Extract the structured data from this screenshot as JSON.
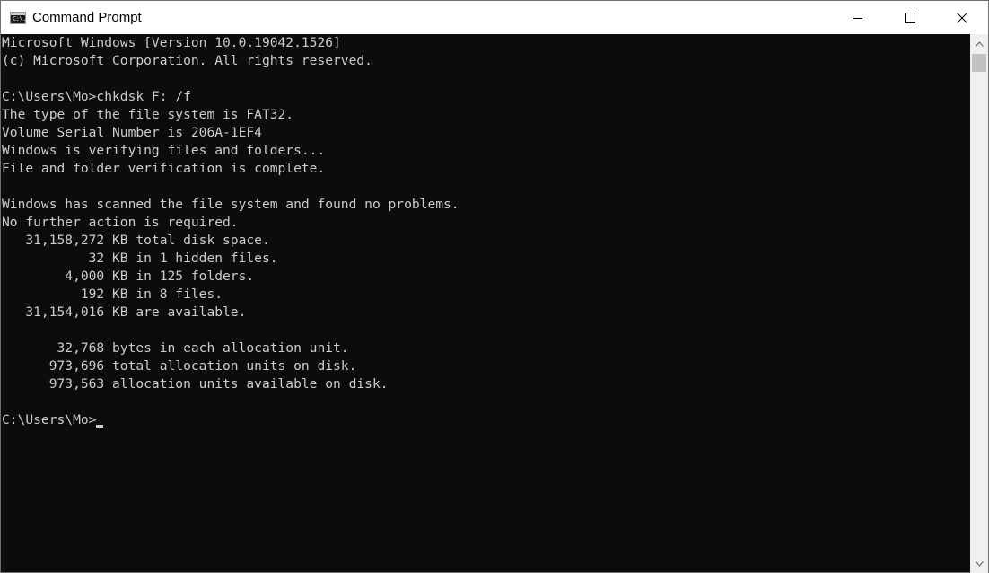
{
  "window": {
    "title": "Command Prompt",
    "icon": "cmd-app-icon",
    "icon_text": "C:\\."
  },
  "caption_buttons": [
    {
      "name": "minimize-icon"
    },
    {
      "name": "maximize-icon"
    },
    {
      "name": "close-icon"
    }
  ],
  "console": {
    "lines": [
      "Microsoft Windows [Version 10.0.19042.1526]",
      "(c) Microsoft Corporation. All rights reserved.",
      "",
      "C:\\Users\\Mo>chkdsk F: /f",
      "The type of the file system is FAT32.",
      "Volume Serial Number is 206A-1EF4",
      "Windows is verifying files and folders...",
      "File and folder verification is complete.",
      "",
      "Windows has scanned the file system and found no problems.",
      "No further action is required.",
      "   31,158,272 KB total disk space.",
      "           32 KB in 1 hidden files.",
      "        4,000 KB in 125 folders.",
      "          192 KB in 8 files.",
      "   31,154,016 KB are available.",
      "",
      "       32,768 bytes in each allocation unit.",
      "      973,696 total allocation units on disk.",
      "      973,563 allocation units available on disk.",
      ""
    ],
    "prompt": "C:\\Users\\Mo>"
  },
  "colors": {
    "console_bg": "#0c0c0c",
    "console_fg": "#cccccc",
    "titlebar_bg": "#ffffff"
  }
}
